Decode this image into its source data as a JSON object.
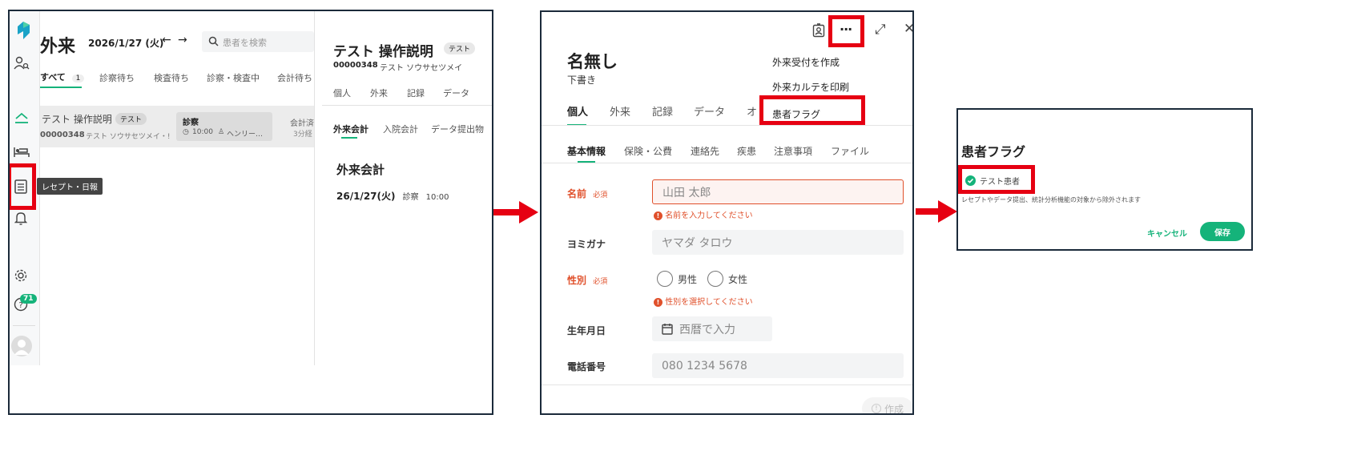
{
  "panel1": {
    "title": "外来",
    "date": "2026/1/27 (火)",
    "search_placeholder": "患者を検索",
    "tabs": [
      "すべて",
      "診察待ち",
      "検査待ち",
      "診察・検査中",
      "会計待ち"
    ],
    "all_count": "1",
    "row": {
      "name": "テスト 操作説明",
      "badge": "テスト",
      "id": "00000348",
      "kana": "テスト ソウサセツメイ・!",
      "status": "診察",
      "time": "10:00",
      "doctor": "ヘンリー…",
      "billing": "会計済",
      "elapsed": "3分経"
    },
    "tooltip": "レセプト・日報",
    "help_badge": "71",
    "detail": {
      "name": "テスト 操作説明",
      "badge": "テスト",
      "id": "00000348",
      "kana": "テスト ソウサセツメイ",
      "tabs": [
        "個人",
        "外来",
        "記録",
        "データ"
      ],
      "subtabs": [
        "外来会計",
        "入院会計",
        "データ提出物"
      ],
      "section": "外来会計",
      "entry_date": "26/1/27(火)",
      "entry_type": "診察",
      "entry_time": "10:00"
    }
  },
  "panel2": {
    "title": "名無し",
    "subtitle": "下書き",
    "tabs": [
      "個人",
      "外来",
      "記録",
      "データ",
      "オ"
    ],
    "menu": [
      "外来受付を作成",
      "外来カルテを印刷",
      "患者フラグ"
    ],
    "subtabs": [
      "基本情報",
      "保険・公費",
      "連絡先",
      "疾患",
      "注意事項",
      "ファイル"
    ],
    "fields": {
      "name_label": "名前",
      "required": "必須",
      "name_placeholder": "山田 太郎",
      "name_error": "名前を入力してください",
      "kana_label": "ヨミガナ",
      "kana_placeholder": "ヤマダ タロウ",
      "sex_label": "性別",
      "male": "男性",
      "female": "女性",
      "sex_error": "性別を選択してください",
      "birth_label": "生年月日",
      "birth_placeholder": "西暦で入力",
      "phone_label": "電話番号",
      "phone_placeholder": "080 1234 5678"
    },
    "create_button": "作成"
  },
  "panel3": {
    "title": "患者フラグ",
    "checkbox_label": "テスト患者",
    "description": "レセプトやデータ提出、統計分析機能の対象から除外されます",
    "cancel": "キャンセル",
    "save": "保存"
  },
  "colors": {
    "accent": "#15b37a",
    "highlight": "#e60012",
    "error": "#e0502b"
  }
}
